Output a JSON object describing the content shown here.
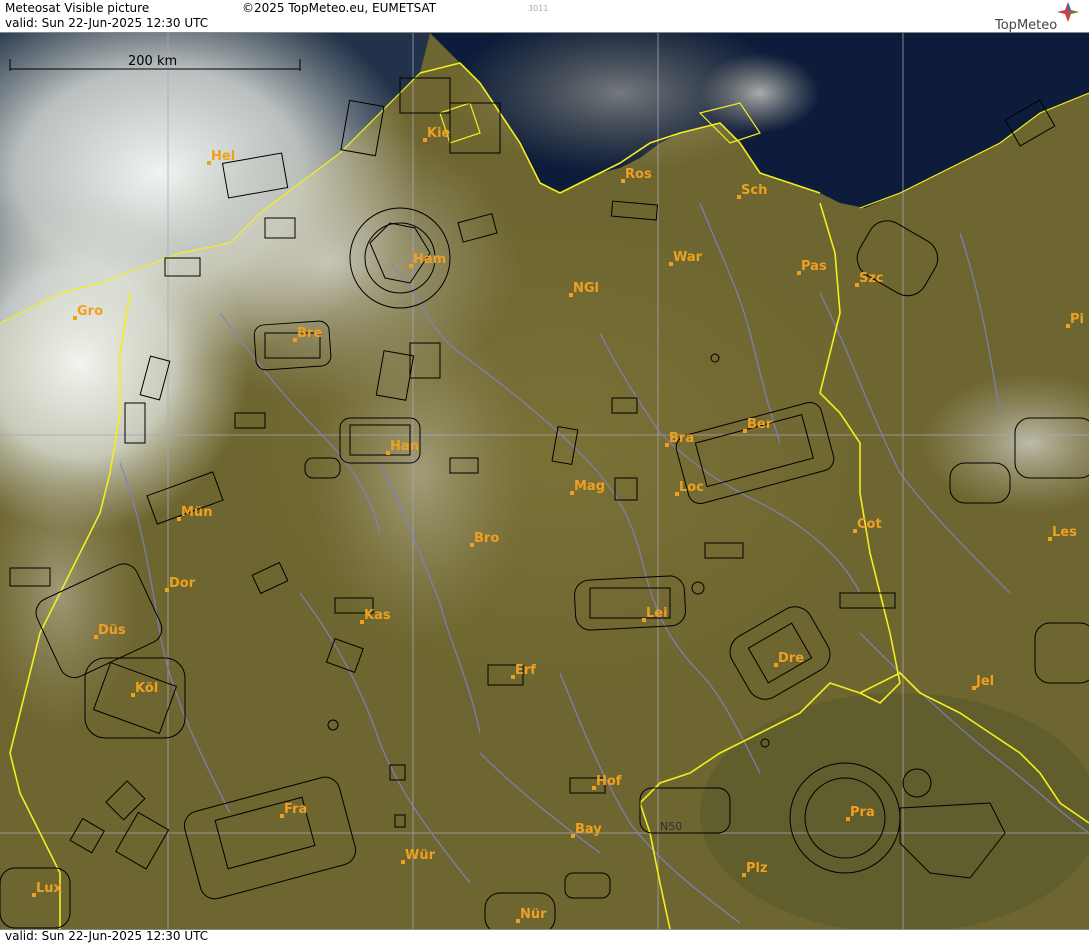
{
  "header": {
    "product": "Meteosat Visible picture",
    "valid": "valid:  Sun  22-Jun-2025  12:30 UTC",
    "copyright": "©2025 TopMeteo.eu, EUMETSAT",
    "code": "3011",
    "logo": "TopMeteo"
  },
  "footer": {
    "valid": "valid:  Sun  22-Jun-2025  12:30 UTC"
  },
  "scale": {
    "label": "200 km"
  },
  "grid_label": "N50",
  "colors": {
    "land": "#6e6630",
    "sea": "#0d1c3a",
    "border": "#f2ee1e",
    "rivers": "#7f82c8",
    "grid": "#a8a8b8",
    "airspace": "#000000",
    "city": "#f0a020",
    "cloud": "#e8ece6"
  },
  "cities": [
    {
      "name": "Kie"
    },
    {
      "name": "Hel"
    },
    {
      "name": "Ros"
    },
    {
      "name": "Sch"
    },
    {
      "name": "Ham"
    },
    {
      "name": "War"
    },
    {
      "name": "Pas"
    },
    {
      "name": "Szc"
    },
    {
      "name": "NGl"
    },
    {
      "name": "Gro"
    },
    {
      "name": "Bre"
    },
    {
      "name": "Pi"
    },
    {
      "name": "Han"
    },
    {
      "name": "Bra"
    },
    {
      "name": "Ber"
    },
    {
      "name": "Mag"
    },
    {
      "name": "Loc"
    },
    {
      "name": "Mün"
    },
    {
      "name": "Bro"
    },
    {
      "name": "Cot"
    },
    {
      "name": "Les"
    },
    {
      "name": "Dor"
    },
    {
      "name": "Kas"
    },
    {
      "name": "Lei"
    },
    {
      "name": "Düs"
    },
    {
      "name": "Erf"
    },
    {
      "name": "Dre"
    },
    {
      "name": "Köl"
    },
    {
      "name": "Jel"
    },
    {
      "name": "Hof"
    },
    {
      "name": "Fra"
    },
    {
      "name": "Bay"
    },
    {
      "name": "Pra"
    },
    {
      "name": "Wür"
    },
    {
      "name": "Plz"
    },
    {
      "name": "Lux"
    },
    {
      "name": "Nür"
    }
  ]
}
